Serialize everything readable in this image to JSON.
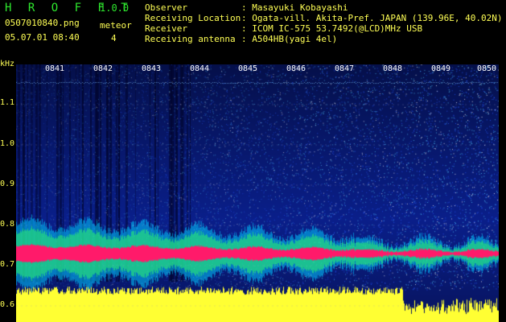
{
  "header": {
    "brand": "H R O F F T",
    "version": "1.0.0",
    "filename": "0507010840.png",
    "datetime": "05.07.01 08:40",
    "meteor_label": "meteor",
    "meteor_count": "4",
    "info": [
      {
        "key": "Observer",
        "value": ": Masayuki Kobayashi"
      },
      {
        "key": "Receiving Location",
        "value": ": Ogata-vill. Akita-Pref. JAPAN (139.96E, 40.02N)"
      },
      {
        "key": "Receiver",
        "value": ": ICOM IC-575 53.7492(@LCD)MHz USB"
      },
      {
        "key": "Receiving antenna",
        "value": ": A504HB(yagi 4el)"
      }
    ]
  },
  "plot": {
    "yunit": "kHz",
    "ytick_labels": [
      "1.1",
      "1.0",
      "0.9",
      "0.8",
      "0.7",
      "0.6"
    ],
    "time_labels": [
      "0841",
      "0842",
      "0843",
      "0844",
      "0845",
      "0846",
      "0847",
      "0848",
      "0849",
      "0850"
    ],
    "colors": {
      "background": "#0a1a7a",
      "echo": "#ff1a6a",
      "noise": "#ffff33",
      "accent": "#2ee72e"
    }
  }
}
